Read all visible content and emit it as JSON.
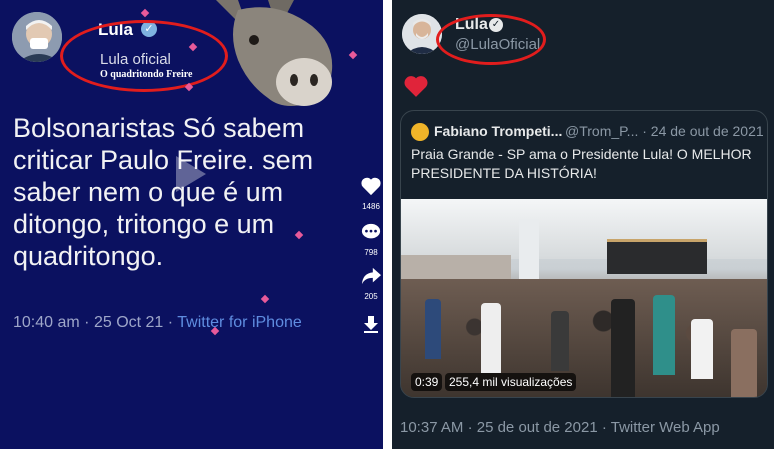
{
  "left": {
    "author_name": "Lula",
    "handle": "Lula oficial",
    "subhandle": "O quadritondo Freire",
    "tweet_text": "Bolsonaristas Só sabem criticar Paulo Freire. sem saber nem o que é um ditongo, tritongo e um quadritongo.",
    "time": "10:40 am",
    "date": "25 Oct 21",
    "source": "Twitter for iPhone",
    "likes": "1486",
    "comments": "798",
    "shares": "205"
  },
  "right": {
    "author_name": "Lula",
    "handle": "@LulaOficial",
    "quoted": {
      "author_name": "Fabiano Trompeti...",
      "handle": "@Trom_P...",
      "date": "· 24 de out de 2021",
      "text": "Praia Grande - SP ama o Presidente Lula! O MELHOR PRESIDENTE DA HISTÓRIA!",
      "video_time": "0:39",
      "video_views": "255,4 mil visualizações"
    },
    "time": "10:37 AM",
    "date": "25 de out de 2021",
    "source": "Twitter Web App"
  },
  "colors": {
    "left_bg": "#0b1160",
    "right_bg": "#15202b",
    "highlight_ring": "#e11d1d",
    "like_red": "#f91880",
    "link_blue": "#5f8de0"
  }
}
